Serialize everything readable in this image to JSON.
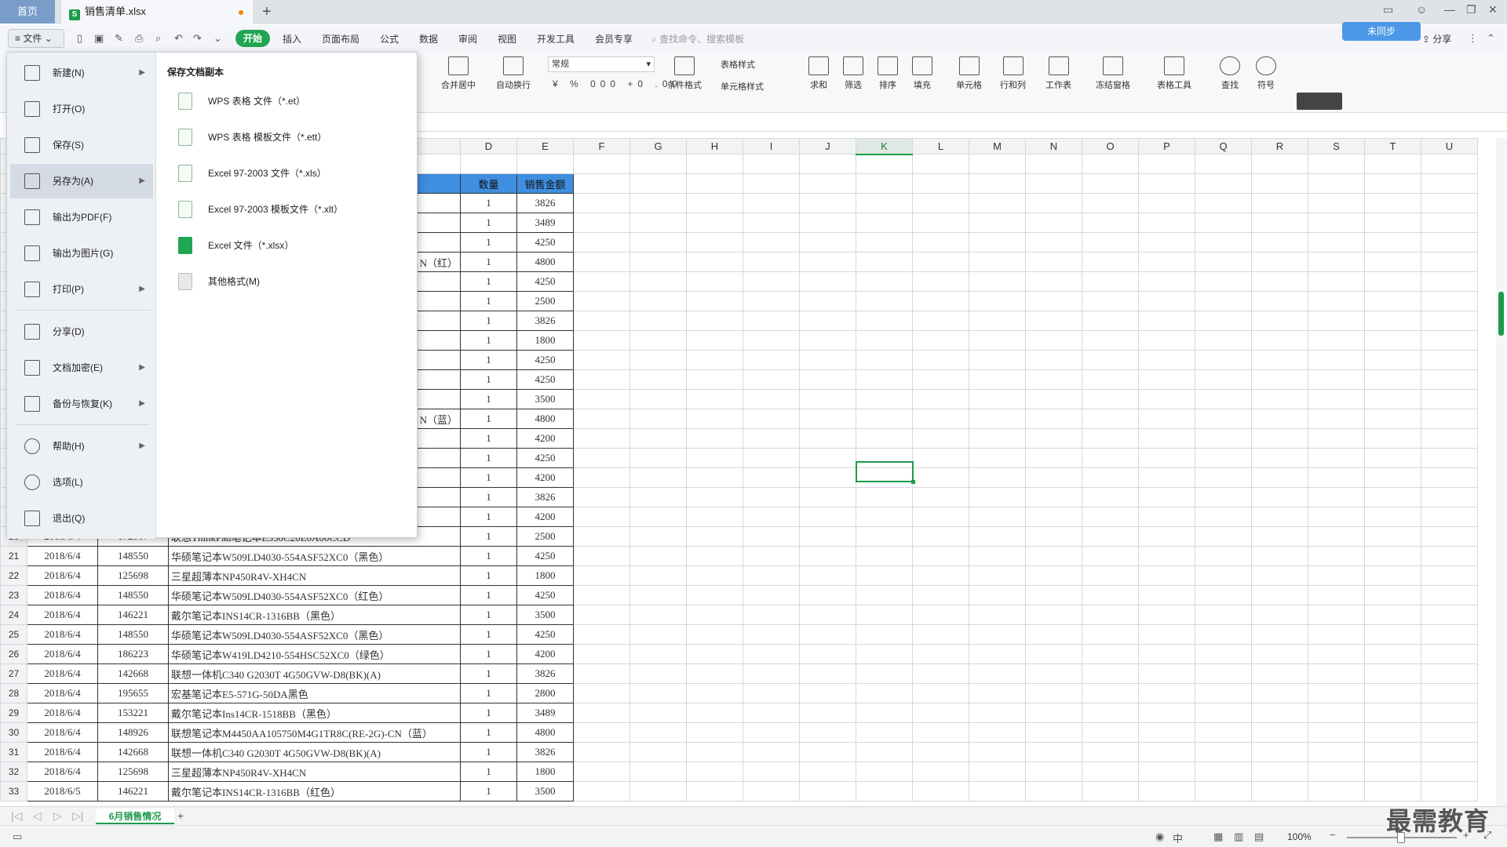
{
  "tabs": {
    "home": "首页",
    "doc": "销售清单.xlsx",
    "add": "+"
  },
  "menubar": {
    "file": "文件",
    "ribbon_tabs": [
      "开始",
      "插入",
      "页面布局",
      "公式",
      "数据",
      "审阅",
      "视图",
      "开发工具",
      "会员专享"
    ],
    "search_placeholder": "查找命令、搜索模板",
    "share": "分享",
    "login": "未同步"
  },
  "ribbon": {
    "merge": "合并居中",
    "wrap": "自动换行",
    "number_format": "常规",
    "number_tools": "¥ % 000 +0 .00",
    "table_style": "表格样式",
    "cond_format": "条件格式",
    "cell_style": "单元格样式",
    "sum": "求和",
    "filter": "筛选",
    "sort": "排序",
    "fill": "填充",
    "cell": "单元格",
    "rowcol": "行和列",
    "sheet": "工作表",
    "freeze": "冻结窗格",
    "tabletools": "表格工具",
    "find": "查找",
    "symbol": "符号"
  },
  "file_menu": {
    "items": [
      {
        "label": "新建(N)",
        "arrow": "▶"
      },
      {
        "label": "打开(O)",
        "arrow": ""
      },
      {
        "label": "保存(S)",
        "arrow": ""
      },
      {
        "label": "另存为(A)",
        "arrow": "▶"
      },
      {
        "label": "输出为PDF(F)",
        "arrow": ""
      },
      {
        "label": "输出为图片(G)",
        "arrow": ""
      },
      {
        "label": "打印(P)",
        "arrow": "▶"
      },
      {
        "label": "分享(D)",
        "arrow": ""
      },
      {
        "label": "文档加密(E)",
        "arrow": "▶"
      },
      {
        "label": "备份与恢复(K)",
        "arrow": "▶"
      },
      {
        "label": "帮助(H)",
        "arrow": "▶"
      },
      {
        "label": "选项(L)",
        "arrow": ""
      },
      {
        "label": "退出(Q)",
        "arrow": ""
      }
    ],
    "save_copy_title": "保存文档副本",
    "save_formats": [
      "WPS 表格 文件（*.et）",
      "WPS 表格 模板文件（*.ett）",
      "Excel 97-2003 文件（*.xls）",
      "Excel 97-2003 模板文件（*.xlt）",
      "Excel 文件（*.xlsx）",
      "其他格式(M)"
    ]
  },
  "grid": {
    "columns": [
      "D",
      "E",
      "F",
      "G",
      "H",
      "I",
      "J",
      "K",
      "L",
      "M",
      "N",
      "O",
      "P",
      "Q",
      "R",
      "S",
      "T",
      "U"
    ],
    "selected_column": "K",
    "header_row": {
      "qty": "数量",
      "amount": "销售金额"
    },
    "partial_rows": [
      {
        "frag": "",
        "qty": "1",
        "amount": "3826"
      },
      {
        "frag": "",
        "qty": "1",
        "amount": "3489"
      },
      {
        "frag": "",
        "qty": "1",
        "amount": "4250"
      },
      {
        "frag": "N（红）",
        "qty": "1",
        "amount": "4800"
      },
      {
        "frag": "",
        "qty": "1",
        "amount": "4250"
      },
      {
        "frag": "",
        "qty": "1",
        "amount": "2500"
      },
      {
        "frag": "",
        "qty": "1",
        "amount": "3826"
      },
      {
        "frag": "",
        "qty": "1",
        "amount": "1800"
      },
      {
        "frag": "",
        "qty": "1",
        "amount": "4250"
      },
      {
        "frag": "",
        "qty": "1",
        "amount": "4250"
      },
      {
        "frag": "",
        "qty": "1",
        "amount": "3500"
      },
      {
        "frag": "N（蓝）",
        "qty": "1",
        "amount": "4800"
      },
      {
        "frag": "",
        "qty": "1",
        "amount": "4200"
      },
      {
        "frag": "",
        "qty": "1",
        "amount": "4250"
      },
      {
        "frag": "",
        "qty": "1",
        "amount": "4200"
      },
      {
        "frag": "",
        "qty": "1",
        "amount": "3826"
      },
      {
        "frag": "",
        "qty": "1",
        "amount": "4200"
      }
    ],
    "full_rows": [
      {
        "row": "20",
        "date": "2018/6/4",
        "code": "172967",
        "product": "联想ThinkPad笔记本E550C20E0A00CCD",
        "qty": "1",
        "amount": "2500"
      },
      {
        "row": "21",
        "date": "2018/6/4",
        "code": "148550",
        "product": "华硕笔记本W509LD4030-554ASF52XC0（黑色）",
        "qty": "1",
        "amount": "4250"
      },
      {
        "row": "22",
        "date": "2018/6/4",
        "code": "125698",
        "product": "三星超薄本NP450R4V-XH4CN",
        "qty": "1",
        "amount": "1800"
      },
      {
        "row": "23",
        "date": "2018/6/4",
        "code": "148550",
        "product": "华硕笔记本W509LD4030-554ASF52XC0（红色）",
        "qty": "1",
        "amount": "4250"
      },
      {
        "row": "24",
        "date": "2018/6/4",
        "code": "146221",
        "product": "戴尔笔记本INS14CR-1316BB（黑色）",
        "qty": "1",
        "amount": "3500"
      },
      {
        "row": "25",
        "date": "2018/6/4",
        "code": "148550",
        "product": "华硕笔记本W509LD4030-554ASF52XC0（黑色）",
        "qty": "1",
        "amount": "4250"
      },
      {
        "row": "26",
        "date": "2018/6/4",
        "code": "186223",
        "product": "华硕笔记本W419LD4210-554HSC52XC0（绿色）",
        "qty": "1",
        "amount": "4200"
      },
      {
        "row": "27",
        "date": "2018/6/4",
        "code": "142668",
        "product": "联想一体机C340 G2030T 4G50GVW-D8(BK)(A)",
        "qty": "1",
        "amount": "3826"
      },
      {
        "row": "28",
        "date": "2018/6/4",
        "code": "195655",
        "product": "宏基笔记本E5-571G-50DA黑色",
        "qty": "1",
        "amount": "2800"
      },
      {
        "row": "29",
        "date": "2018/6/4",
        "code": "153221",
        "product": "戴尔笔记本Ins14CR-1518BB（黑色）",
        "qty": "1",
        "amount": "3489"
      },
      {
        "row": "30",
        "date": "2018/6/4",
        "code": "148926",
        "product": "联想笔记本M4450AA105750M4G1TR8C(RE-2G)-CN（蓝）",
        "qty": "1",
        "amount": "4800"
      },
      {
        "row": "31",
        "date": "2018/6/4",
        "code": "142668",
        "product": "联想一体机C340 G2030T 4G50GVW-D8(BK)(A)",
        "qty": "1",
        "amount": "3826"
      },
      {
        "row": "32",
        "date": "2018/6/4",
        "code": "125698",
        "product": "三星超薄本NP450R4V-XH4CN",
        "qty": "1",
        "amount": "1800"
      },
      {
        "row": "33",
        "date": "2018/6/5",
        "code": "146221",
        "product": "戴尔笔记本INS14CR-1316BB（红色）",
        "qty": "1",
        "amount": "3500"
      }
    ]
  },
  "sheetbar": {
    "sheet_name": "6月销售情况",
    "add": "+"
  },
  "status": {
    "zoom": "100%"
  },
  "watermark": "最需教育",
  "colors": {
    "accent": "#1e9a4c",
    "header_fill": "#3f8ee0"
  }
}
